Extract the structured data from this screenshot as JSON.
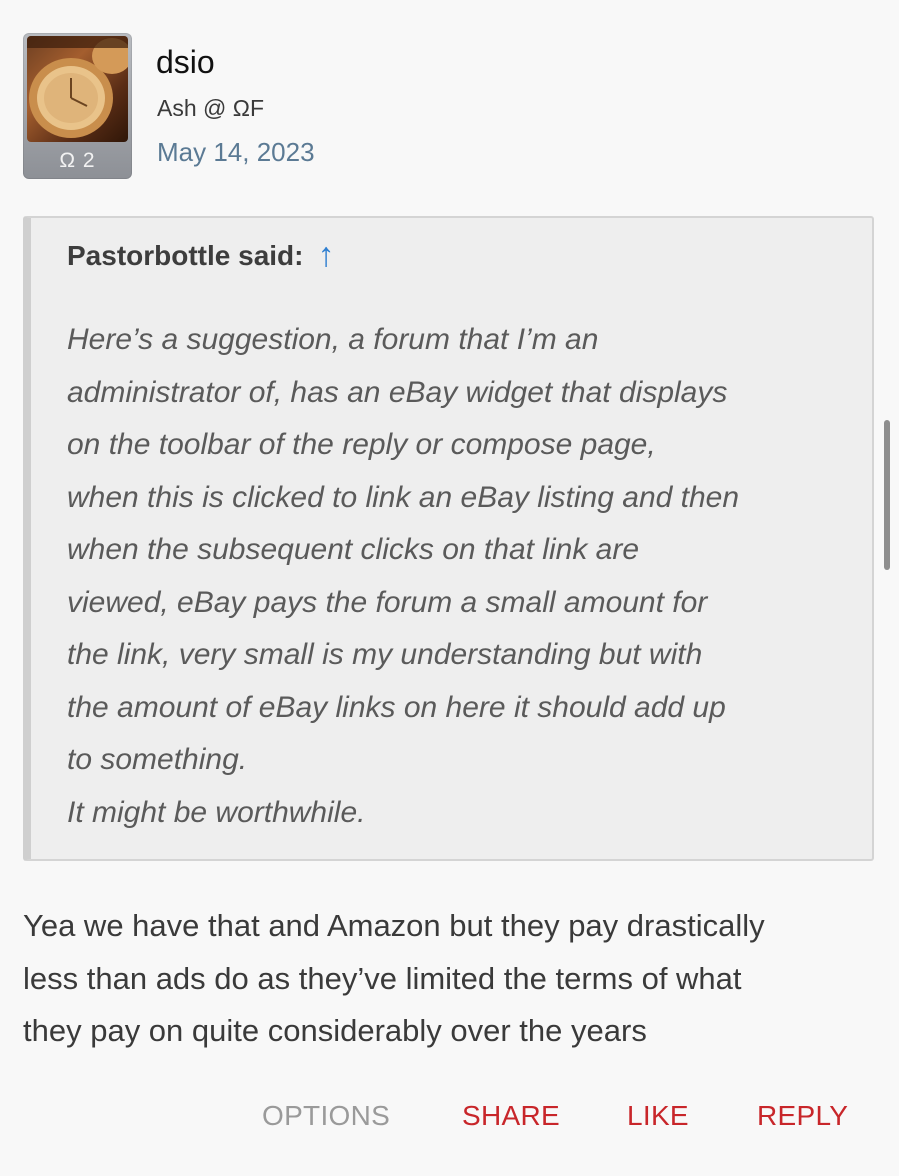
{
  "post": {
    "username": "dsio",
    "user_title": "Ash @ ΩF",
    "date": "May 14, 2023",
    "avatar_badge": "Ω 2"
  },
  "quote": {
    "attribution": "Pastorbottle said:",
    "arrow_icon": "↑",
    "lines": [
      "Here’s a suggestion, a forum that I’m an",
      "administrator of, has an eBay widget that displays",
      "on the toolbar of the reply or compose page,",
      "when this is clicked to link an eBay listing and then",
      "when the subsequent clicks on that link are",
      "viewed, eBay pays the forum a small amount for",
      "the link, very small is my understanding but with",
      "the amount of eBay links on here it should add up",
      "to something.",
      "It might be worthwhile."
    ]
  },
  "reply": {
    "lines": [
      "Yea we have that and Amazon but they pay drastically",
      "less than ads do as they’ve limited the terms of what",
      "they pay on quite considerably over the years"
    ]
  },
  "actions": {
    "options": "OPTIONS",
    "share": "SHARE",
    "like": "LIKE",
    "reply": "REPLY"
  },
  "colors": {
    "link_date": "#5b7a94",
    "action_red": "#c8262a",
    "quote_arrow": "#2f7fd0"
  }
}
